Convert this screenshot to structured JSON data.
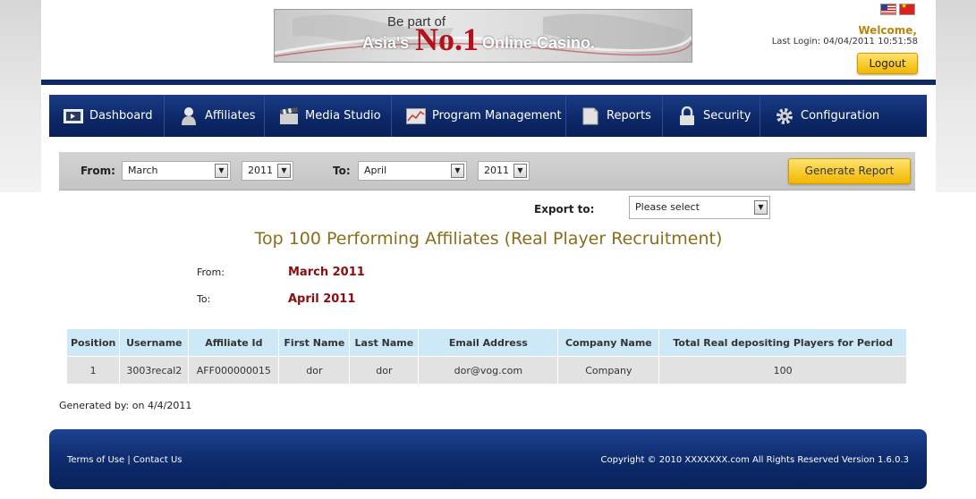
{
  "header": {
    "banner": {
      "line1": "Be part of",
      "asia": "Asia's",
      "no1": "No.1",
      "online_casino": "Online Casino."
    },
    "welcome": "Welcome,",
    "last_login": "Last Login: 04/04/2011 10:51:58",
    "logout_label": "Logout"
  },
  "nav": {
    "items": [
      {
        "label": "Dashboard",
        "icon": "dashboard-icon"
      },
      {
        "label": "Affiliates",
        "icon": "user-icon"
      },
      {
        "label": "Media Studio",
        "icon": "clapperboard-icon"
      },
      {
        "label": "Program Management",
        "icon": "chart-icon"
      },
      {
        "label": "Reports",
        "icon": "report-icon"
      },
      {
        "label": "Security",
        "icon": "lock-icon"
      },
      {
        "label": "Configuration",
        "icon": "gear-icon"
      }
    ]
  },
  "filters": {
    "from_label": "From:",
    "from_month": "March",
    "from_year": "2011",
    "to_label": "To:",
    "to_month": "April",
    "to_year": "2011",
    "generate_label": "Generate Report",
    "export_label": "Export to:",
    "export_value": "Please select"
  },
  "report": {
    "title": "Top 100 Performing Affiliates (Real Player Recruitment)",
    "from_label": "From:",
    "from_value": "March 2011",
    "to_label": "To:",
    "to_value": "April 2011",
    "columns": [
      "Position",
      "Username",
      "Affiliate Id",
      "First Name",
      "Last Name",
      "Email Address",
      "Company Name",
      "Total Real depositing Players for Period"
    ],
    "rows": [
      [
        "1",
        "3003recal2",
        "AFF000000015",
        "dor",
        "dor",
        "dor@vog.com",
        "Company",
        "100"
      ]
    ],
    "generated_by": "Generated by: on 4/4/2011"
  },
  "footer": {
    "terms": "Terms of Use",
    "separator": "|",
    "contact": "Contact Us",
    "copyright": "Copyright © 2010 XXXXXXX.com All Rights Reserved  Version 1.6.0.3"
  },
  "colors": {
    "nav_bg": "#0c2767",
    "accent_gold": "#f2b600",
    "title_gold": "#8a6d1b",
    "value_red": "#8b0d0d",
    "table_header": "#cde8f7"
  }
}
